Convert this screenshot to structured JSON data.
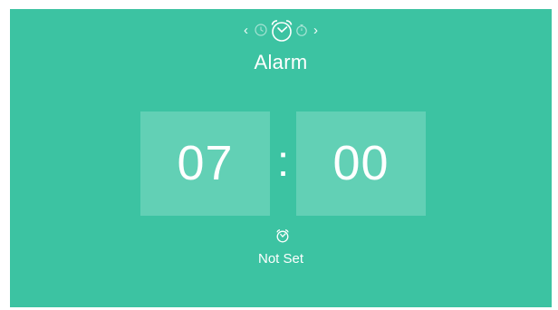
{
  "nav": {
    "prev_icon": "chevron-left-icon",
    "next_icon": "chevron-right-icon",
    "prev_glyph": "‹",
    "next_glyph": "›",
    "modes": [
      "clock-icon",
      "alarm-clock-icon",
      "stopwatch-icon"
    ]
  },
  "page": {
    "title": "Alarm"
  },
  "alarm": {
    "hours": "07",
    "separator": ":",
    "minutes": "00",
    "status_icon": "alarm-clock-icon",
    "status": "Not Set"
  },
  "colors": {
    "background": "#3cc3a2",
    "tile": "#62d0b5",
    "text": "#ffffff"
  }
}
